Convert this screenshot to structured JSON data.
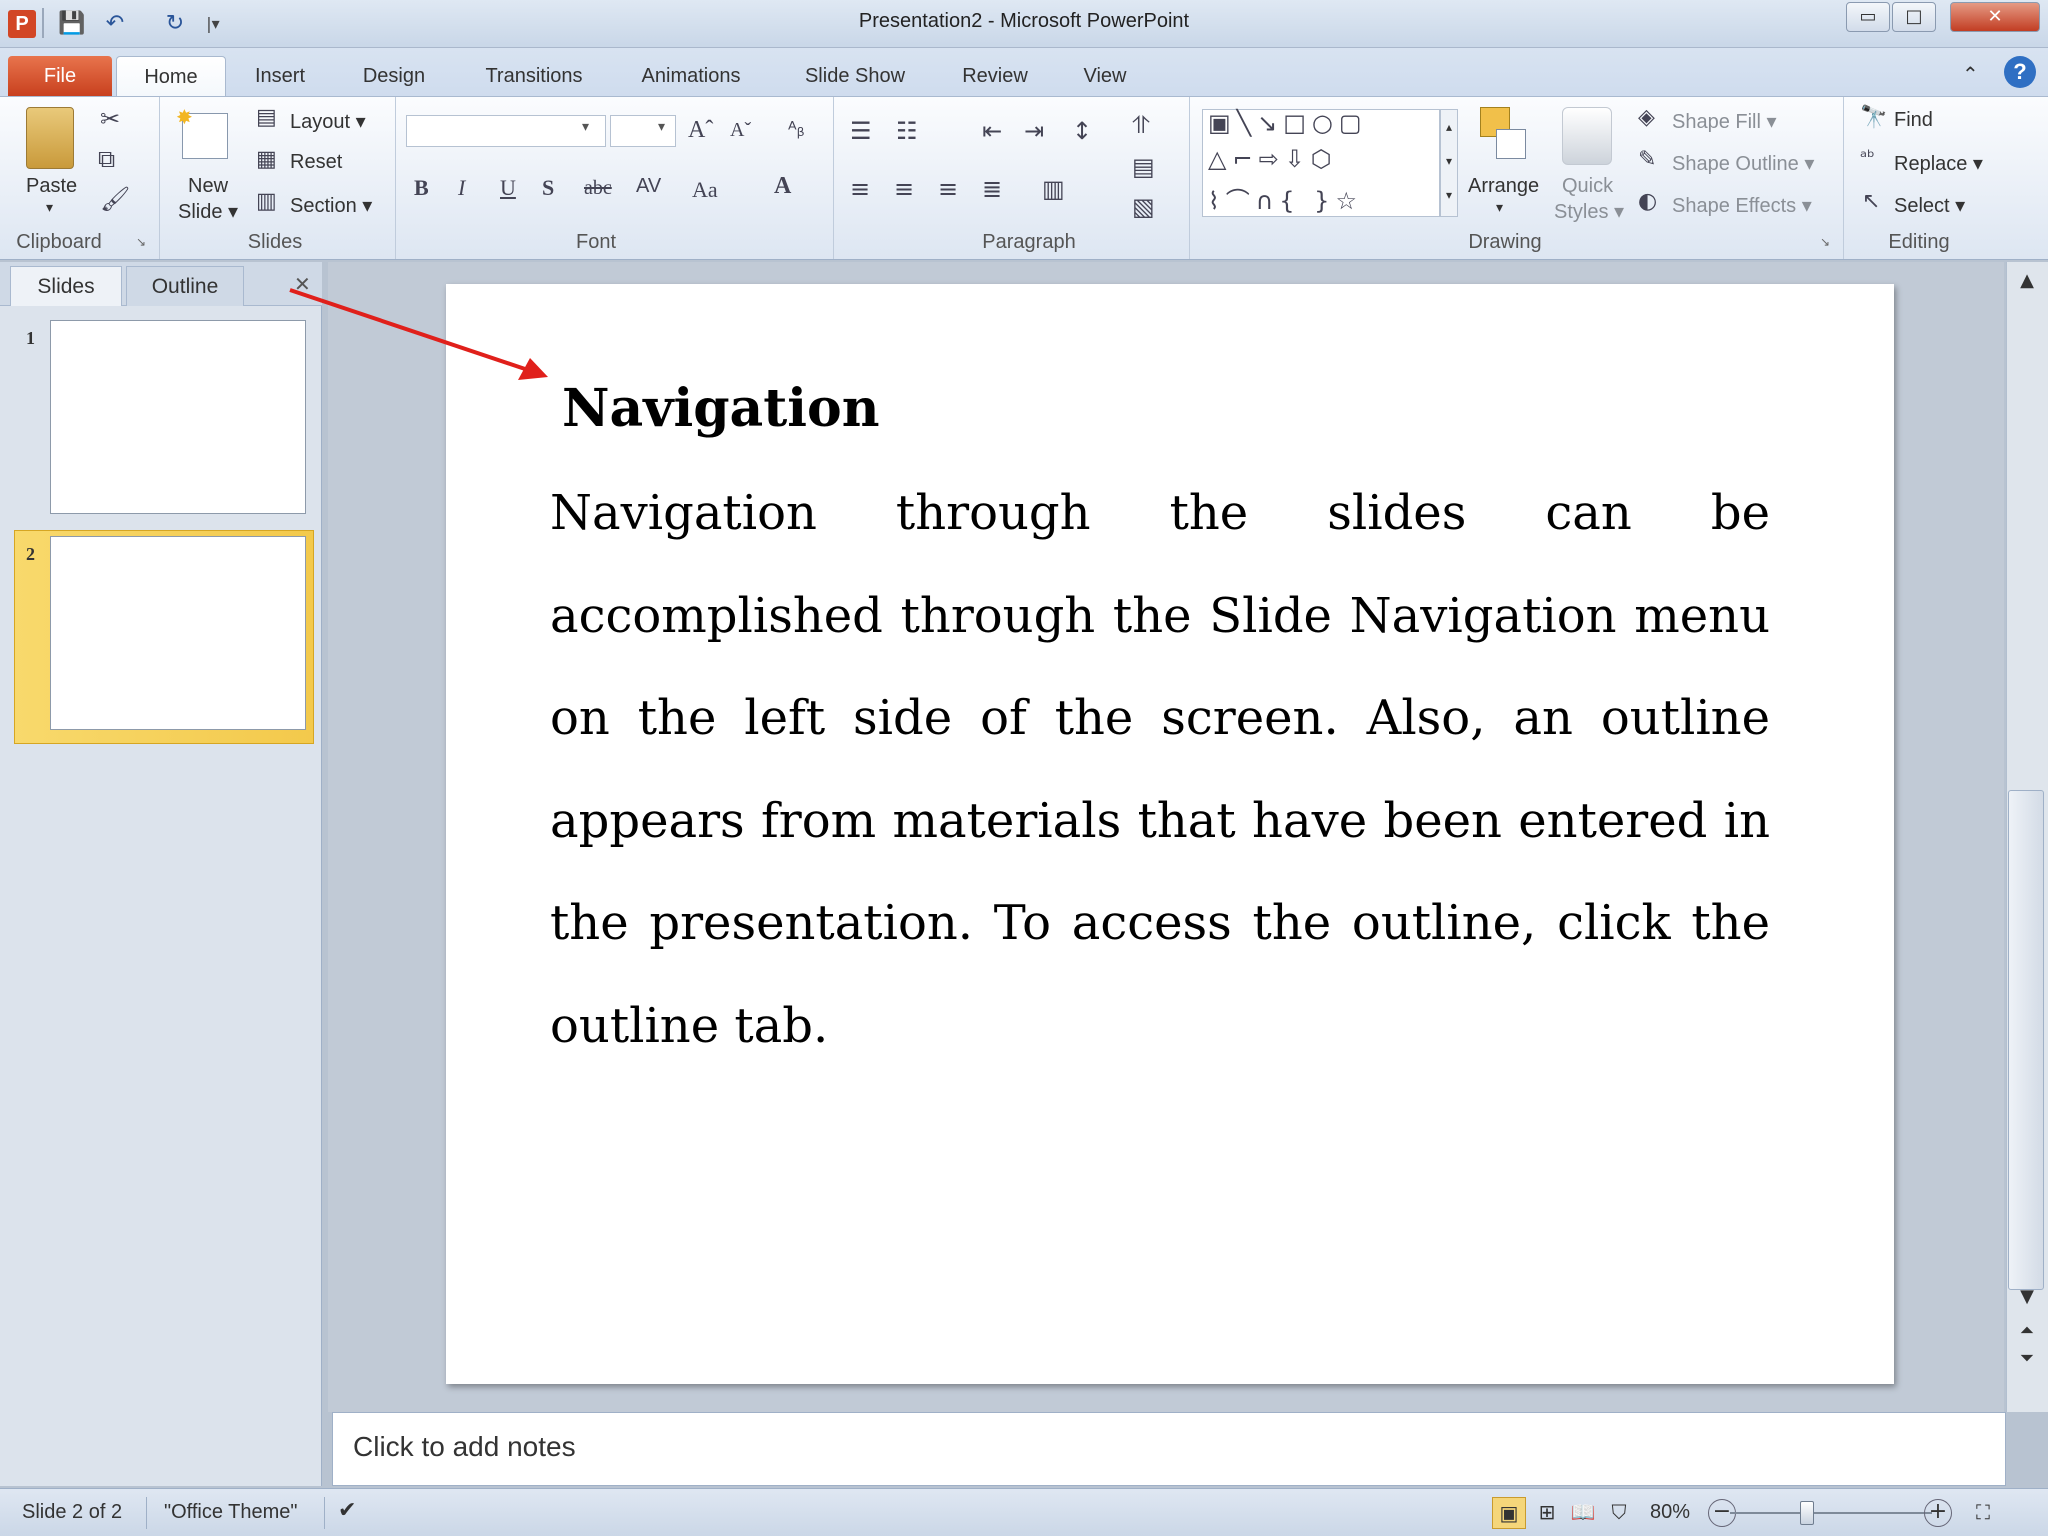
{
  "titlebar": {
    "app_icon": "P",
    "title": "Presentation2  -  Microsoft PowerPoint",
    "controls": {
      "minimize": "▭",
      "maximize": "□",
      "close": "✕"
    }
  },
  "qat": {
    "save": "💾",
    "undo": "↶",
    "redo": "↻",
    "customize": "|▾"
  },
  "tabs": [
    "File",
    "Home",
    "Insert",
    "Design",
    "Transitions",
    "Animations",
    "Slide Show",
    "Review",
    "View"
  ],
  "ribbon": {
    "clipboard": {
      "paste": "Paste",
      "label": "Clipboard"
    },
    "slides": {
      "new_slide_1": "New",
      "new_slide_2": "Slide ▾",
      "layout": "Layout ▾",
      "reset": "Reset",
      "section": "Section ▾",
      "label": "Slides"
    },
    "font": {
      "label": "Font",
      "bold": "B",
      "italic": "I",
      "underline": "U",
      "shadow": "S",
      "strike": "abc",
      "spacing": "AV",
      "case": "Aa",
      "color": "A"
    },
    "paragraph": {
      "label": "Paragraph"
    },
    "drawing": {
      "arrange": "Arrange",
      "quick_styles_1": "Quick",
      "quick_styles_2": "Styles ▾",
      "shape_fill": "Shape Fill ▾",
      "shape_outline": "Shape Outline ▾",
      "shape_effects": "Shape Effects ▾",
      "label": "Drawing"
    },
    "editing": {
      "find": "Find",
      "replace": "Replace ▾",
      "select": "Select ▾",
      "label": "Editing"
    }
  },
  "panel": {
    "tab_slides": "Slides",
    "tab_outline": "Outline",
    "close": "✕",
    "thumbs": [
      "1",
      "2"
    ],
    "selected_index": 2
  },
  "slide": {
    "title": "Navigation",
    "body": "Navigation through the slides can be accomplished through the Slide Navigation menu on the left side of the screen. Also, an outline appears from materials that have been entered in the presentation. To access the outline, click the outline tab."
  },
  "notes": {
    "placeholder": "Click to add notes"
  },
  "status": {
    "slide": "Slide 2 of 2",
    "theme": "\"Office Theme\"",
    "zoom": "80%",
    "zoom_minus": "−",
    "zoom_plus": "+"
  },
  "annotation": {
    "arrow_color": "#e0201b"
  },
  "colors": {
    "file_tab": "#d24625",
    "selected_thumb": "#f7d56a"
  }
}
